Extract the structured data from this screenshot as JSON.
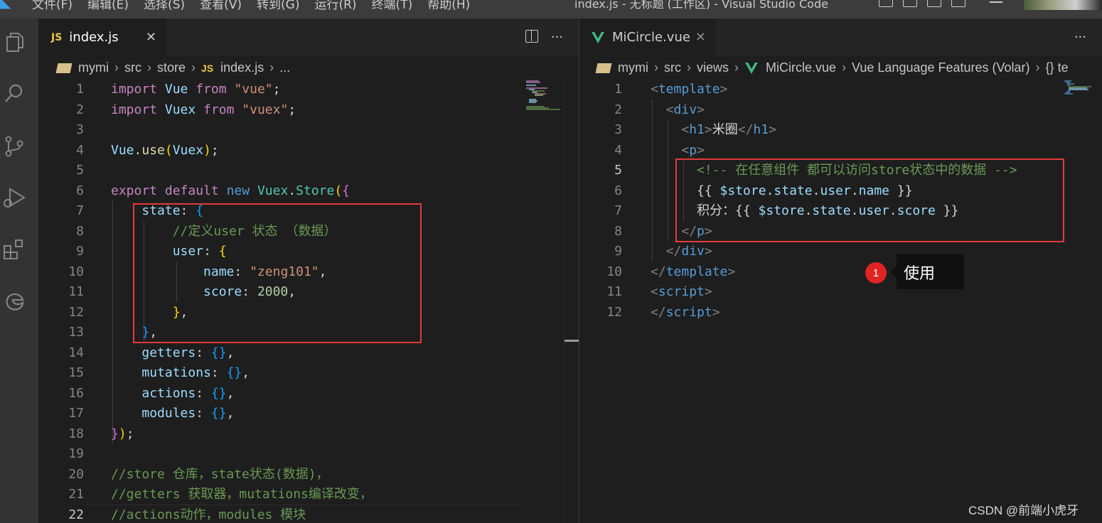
{
  "titlebar": {
    "menus": [
      "文件(F)",
      "编辑(E)",
      "选择(S)",
      "查看(V)",
      "转到(G)",
      "运行(R)",
      "终端(T)",
      "帮助(H)"
    ],
    "window_title": "index.js - 无标题 (工作区) - Visual Studio Code"
  },
  "left_editor": {
    "tab_badge": "JS",
    "tab_label": "index.js",
    "breadcrumb": [
      "mymi",
      "src",
      "store",
      "index.js",
      "..."
    ],
    "breadcrumb_badge": "JS",
    "lines": [
      {
        "no": "1",
        "tokens": [
          [
            "k",
            "import"
          ],
          [
            "p",
            " "
          ],
          [
            "v",
            "Vue"
          ],
          [
            "p",
            " "
          ],
          [
            "k",
            "from"
          ],
          [
            "p",
            " "
          ],
          [
            "s",
            "\"vue\""
          ],
          [
            "p",
            ";"
          ]
        ]
      },
      {
        "no": "2",
        "tokens": [
          [
            "k",
            "import"
          ],
          [
            "p",
            " "
          ],
          [
            "v",
            "Vuex"
          ],
          [
            "p",
            " "
          ],
          [
            "k",
            "from"
          ],
          [
            "p",
            " "
          ],
          [
            "s",
            "\"vuex\""
          ],
          [
            "p",
            ";"
          ]
        ]
      },
      {
        "no": "3",
        "tokens": []
      },
      {
        "no": "4",
        "tokens": [
          [
            "v",
            "Vue"
          ],
          [
            "p",
            "."
          ],
          [
            "f",
            "use"
          ],
          [
            "y",
            "("
          ],
          [
            "v",
            "Vuex"
          ],
          [
            "y",
            ")"
          ],
          [
            "p",
            ";"
          ]
        ]
      },
      {
        "no": "5",
        "tokens": []
      },
      {
        "no": "6",
        "tokens": [
          [
            "k",
            "export"
          ],
          [
            "p",
            " "
          ],
          [
            "k",
            "default"
          ],
          [
            "p",
            " "
          ],
          [
            "kb",
            "new"
          ],
          [
            "p",
            " "
          ],
          [
            "t",
            "Vuex"
          ],
          [
            "p",
            "."
          ],
          [
            "t",
            "Store"
          ],
          [
            "y",
            "("
          ],
          [
            "pk",
            "{"
          ]
        ]
      },
      {
        "no": "7",
        "tokens": [
          [
            "p",
            "    "
          ],
          [
            "v",
            "state"
          ],
          [
            "p",
            ": "
          ],
          [
            "bl",
            "{"
          ]
        ]
      },
      {
        "no": "8",
        "tokens": [
          [
            "p",
            "        "
          ],
          [
            "c",
            "//定义user 状态 （数据）"
          ]
        ]
      },
      {
        "no": "9",
        "tokens": [
          [
            "p",
            "        "
          ],
          [
            "v",
            "user"
          ],
          [
            "p",
            ": "
          ],
          [
            "y",
            "{"
          ]
        ]
      },
      {
        "no": "10",
        "tokens": [
          [
            "p",
            "            "
          ],
          [
            "v",
            "name"
          ],
          [
            "p",
            ": "
          ],
          [
            "s",
            "\"zeng101\""
          ],
          [
            "p",
            ","
          ]
        ]
      },
      {
        "no": "11",
        "tokens": [
          [
            "p",
            "            "
          ],
          [
            "v",
            "score"
          ],
          [
            "p",
            ": "
          ],
          [
            "n",
            "2000"
          ],
          [
            "p",
            ","
          ]
        ]
      },
      {
        "no": "12",
        "tokens": [
          [
            "p",
            "        "
          ],
          [
            "y",
            "}"
          ],
          [
            "p",
            ","
          ]
        ]
      },
      {
        "no": "13",
        "tokens": [
          [
            "p",
            "    "
          ],
          [
            "bl",
            "}"
          ],
          [
            "p",
            ","
          ]
        ]
      },
      {
        "no": "14",
        "tokens": [
          [
            "p",
            "    "
          ],
          [
            "v",
            "getters"
          ],
          [
            "p",
            ": "
          ],
          [
            "bl",
            "{}"
          ],
          [
            "p",
            ","
          ]
        ]
      },
      {
        "no": "15",
        "tokens": [
          [
            "p",
            "    "
          ],
          [
            "v",
            "mutations"
          ],
          [
            "p",
            ": "
          ],
          [
            "bl",
            "{}"
          ],
          [
            "p",
            ","
          ]
        ]
      },
      {
        "no": "16",
        "tokens": [
          [
            "p",
            "    "
          ],
          [
            "v",
            "actions"
          ],
          [
            "p",
            ": "
          ],
          [
            "bl",
            "{}"
          ],
          [
            "p",
            ","
          ]
        ]
      },
      {
        "no": "17",
        "tokens": [
          [
            "p",
            "    "
          ],
          [
            "v",
            "modules"
          ],
          [
            "p",
            ": "
          ],
          [
            "bl",
            "{}"
          ],
          [
            "p",
            ","
          ]
        ]
      },
      {
        "no": "18",
        "tokens": [
          [
            "pk",
            "}"
          ],
          [
            "y",
            ")"
          ],
          [
            "p",
            ";"
          ]
        ]
      },
      {
        "no": "19",
        "tokens": []
      },
      {
        "no": "20",
        "tokens": [
          [
            "c",
            "//store 仓库，state状态(数据)，"
          ]
        ]
      },
      {
        "no": "21",
        "tokens": [
          [
            "c",
            "//getters 获取器，mutations编译改变，"
          ]
        ]
      },
      {
        "no": "22",
        "tokens": [
          [
            "c",
            "//actions动作，modules 模块"
          ]
        ]
      }
    ]
  },
  "right_editor": {
    "tab_label": "MiCircle.vue",
    "breadcrumb": [
      "mymi",
      "src",
      "views",
      "MiCircle.vue",
      "Vue Language Features (Volar)",
      "{} te"
    ],
    "lines": [
      {
        "no": "1",
        "tokens": [
          [
            "gr",
            "<"
          ],
          [
            "tg",
            "template"
          ],
          [
            "gr",
            ">"
          ]
        ]
      },
      {
        "no": "2",
        "tokens": [
          [
            "p",
            "  "
          ],
          [
            "gr",
            "<"
          ],
          [
            "tg",
            "div"
          ],
          [
            "gr",
            ">"
          ]
        ]
      },
      {
        "no": "3",
        "tokens": [
          [
            "p",
            "    "
          ],
          [
            "gr",
            "<"
          ],
          [
            "tg",
            "h1"
          ],
          [
            "gr",
            ">"
          ],
          [
            "w",
            "米圈"
          ],
          [
            "gr",
            "</"
          ],
          [
            "tg",
            "h1"
          ],
          [
            "gr",
            ">"
          ]
        ]
      },
      {
        "no": "4",
        "tokens": [
          [
            "p",
            "    "
          ],
          [
            "gr",
            "<"
          ],
          [
            "tg",
            "p"
          ],
          [
            "gr",
            ">"
          ]
        ]
      },
      {
        "no": "5",
        "tokens": [
          [
            "p",
            "      "
          ],
          [
            "c",
            "<!-- 在任意组件 都可以访问store状态中的数据 -->"
          ]
        ]
      },
      {
        "no": "6",
        "tokens": [
          [
            "p",
            "      "
          ],
          [
            "w",
            "{{ "
          ],
          [
            "v",
            "$store"
          ],
          [
            "w",
            "."
          ],
          [
            "v",
            "state"
          ],
          [
            "w",
            "."
          ],
          [
            "v",
            "user"
          ],
          [
            "w",
            "."
          ],
          [
            "v",
            "name"
          ],
          [
            "w",
            " }}"
          ]
        ]
      },
      {
        "no": "7",
        "tokens": [
          [
            "p",
            "      "
          ],
          [
            "w",
            "积分：{{ "
          ],
          [
            "v",
            "$store"
          ],
          [
            "w",
            "."
          ],
          [
            "v",
            "state"
          ],
          [
            "w",
            "."
          ],
          [
            "v",
            "user"
          ],
          [
            "w",
            "."
          ],
          [
            "v",
            "score"
          ],
          [
            "w",
            " }}"
          ]
        ]
      },
      {
        "no": "8",
        "tokens": [
          [
            "p",
            "    "
          ],
          [
            "gr",
            "</"
          ],
          [
            "tg",
            "p"
          ],
          [
            "gr",
            ">"
          ]
        ]
      },
      {
        "no": "9",
        "tokens": [
          [
            "p",
            "  "
          ],
          [
            "gr",
            "</"
          ],
          [
            "tg",
            "div"
          ],
          [
            "gr",
            ">"
          ]
        ]
      },
      {
        "no": "10",
        "tokens": [
          [
            "gr",
            "</"
          ],
          [
            "tg",
            "template"
          ],
          [
            "gr",
            ">"
          ]
        ]
      },
      {
        "no": "11",
        "tokens": [
          [
            "gr",
            "<"
          ],
          [
            "tg",
            "script"
          ],
          [
            "gr",
            ">"
          ]
        ]
      },
      {
        "no": "12",
        "tokens": [
          [
            "gr",
            "</"
          ],
          [
            "tg",
            "script"
          ],
          [
            "gr",
            ">"
          ]
        ]
      }
    ]
  },
  "annotation": {
    "number": "1",
    "label": "使用"
  },
  "watermark": "CSDN @前端小虎牙",
  "colors": {
    "highlight_box": "#e23b3b",
    "marker": "#e02424",
    "accent_vscode": "#3b9fe8"
  }
}
